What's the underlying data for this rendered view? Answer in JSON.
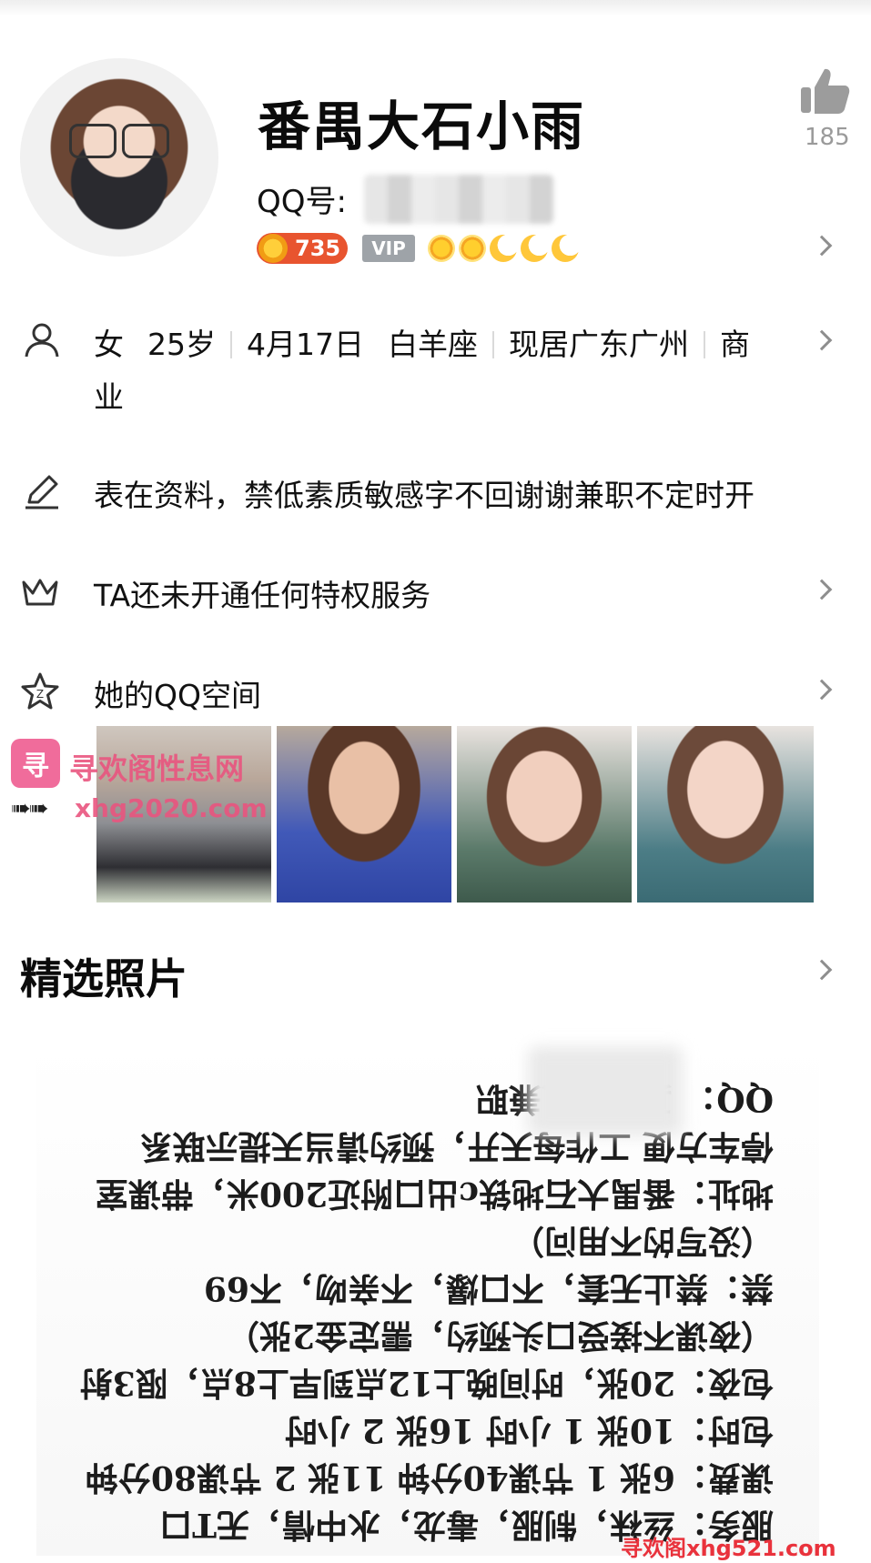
{
  "profile": {
    "nickname": "番禺大石小雨",
    "qq_label": "QQ号:",
    "coin_value": "735",
    "vip_label": "VIP",
    "like_count": "185"
  },
  "info": {
    "gender": "女",
    "age": "25岁",
    "birthday": "4月17日",
    "zodiac": "白羊座",
    "location": "现居广东广州",
    "job_part1": "商",
    "job_part2": "业",
    "signature": "表在资料，禁低素质敏感字不回谢谢兼职不定时开",
    "privilege": "TA还未开通任何特权服务",
    "space": "她的QQ空间"
  },
  "watermark": {
    "logo_char": "寻",
    "title": "寻欢阁性息网",
    "arrow": "➠➠",
    "url": "xhg2020.com",
    "bottom": "寻欢阁xhg521.com"
  },
  "featured": {
    "title": "精选照片"
  },
  "doc_lines": [
    "服务：丝袜，制服，毒龙，水中情，无T口",
    "课费：6张 1 节课40分钟 11张 2 节课80分钟",
    "包时：10张 1 小时    16张 2 小时",
    "包夜：20张，时间晚上12点到早上8点，限3射",
    "（夜课不接受口头预约，需定金2张）",
    "禁：禁止无套，不口爆，不亲吻，不69",
    "（没写的不用问）",
    "地址：番禺大石地铁c出口附近200米，带课室",
    "停车方便  工作每天开，预约请当天提示联系",
    "QQ：       真实本人兼职"
  ]
}
